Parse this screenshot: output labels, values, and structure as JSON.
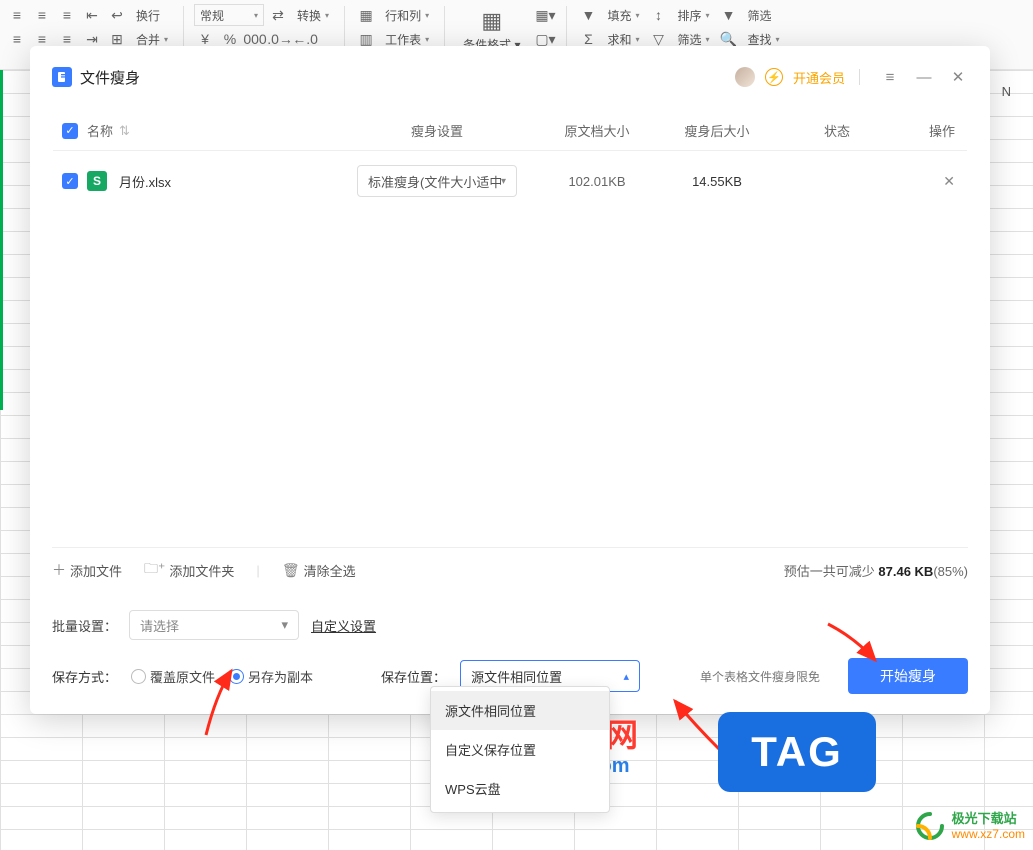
{
  "ribbon": {
    "normal": "常规",
    "convert": "转换",
    "rowcol": "行和列",
    "merge": "合并",
    "worksheet": "工作表",
    "condfmt": "条件格式",
    "fill": "填充",
    "sort": "排序",
    "filter_h": "筛选",
    "sum": "求和",
    "filter": "筛选",
    "find": "查找"
  },
  "modal": {
    "title": "文件瘦身",
    "vip": "开通会员"
  },
  "table": {
    "headers": {
      "name": "名称",
      "setting": "瘦身设置",
      "orig": "原文档大小",
      "after": "瘦身后大小",
      "status": "状态",
      "action": "操作"
    },
    "row1": {
      "file": "月份.xlsx",
      "setting": "标准瘦身(文件大小适中",
      "orig": "102.01KB",
      "after": "14.55KB"
    }
  },
  "footer": {
    "addFile": "添加文件",
    "addFolder": "添加文件夹",
    "clearAll": "清除全选",
    "estimate_prefix": "预估一共可减少 ",
    "estimate_value": "87.46 KB",
    "estimate_pct": "(85%)"
  },
  "batch": {
    "label": "批量设置：",
    "placeholder": "请选择",
    "custom": "自定义设置"
  },
  "save": {
    "label": "保存方式：",
    "opt_overwrite": "覆盖原文件",
    "opt_copy": "另存为副本",
    "loc_label": "保存位置：",
    "loc_value": "源文件相同位置",
    "limit": "单个表格文件瘦身限免",
    "start": "开始瘦身"
  },
  "dropdown": {
    "opt1": "源文件相同位置",
    "opt2": "自定义保存位置",
    "opt3": "WPS云盘"
  },
  "sheet_col": "N",
  "watermark": {
    "mid_title": "电脑技术网",
    "mid_url": "www.tagxp.com",
    "tag": "TAG",
    "corner_title": "极光下载站",
    "corner_url": "www.xz7.com"
  }
}
